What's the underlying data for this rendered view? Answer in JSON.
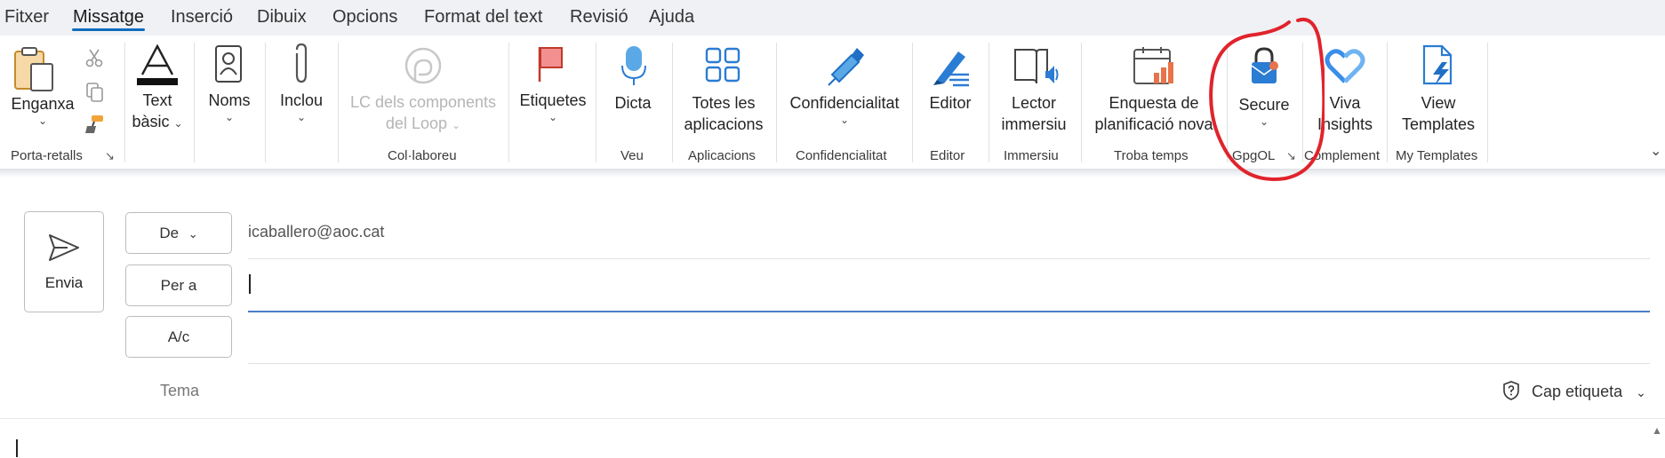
{
  "menu": {
    "items": [
      "Fitxer",
      "Missatge",
      "Inserció",
      "Dibuix",
      "Opcions",
      "Format del text",
      "Revisió",
      "Ajuda"
    ],
    "active": "Missatge"
  },
  "ribbon": {
    "clipboard": {
      "paste": "Enganxa",
      "group": "Porta-retalls"
    },
    "basic_text": {
      "line1": "Text",
      "line2": "bàsic"
    },
    "names": "Noms",
    "include": "Inclou",
    "loop": {
      "line1": "LC dels components",
      "line2": "del Loop"
    },
    "collab_group": "Col·laboreu",
    "tags": "Etiquetes",
    "dictate": "Dicta",
    "voice_group": "Veu",
    "all_apps": {
      "line1": "Totes les",
      "line2": "aplicacions"
    },
    "apps_group": "Aplicacions",
    "confidentiality": "Confidencialitat",
    "confidentiality_group": "Confidencialitat",
    "editor": "Editor",
    "editor_group": "Editor",
    "immersive": {
      "line1": "Lector",
      "line2": "immersiu"
    },
    "immersive_group": "Immersiu",
    "poll": {
      "line1": "Enquesta de",
      "line2": "planificació nova"
    },
    "time_group": "Troba temps",
    "secure": "Secure",
    "gpgol_group": "GpgOL",
    "viva": {
      "line1": "Viva",
      "line2": "Insights"
    },
    "complement_group": "Complement",
    "templates": {
      "line1": "View",
      "line2": "Templates"
    },
    "templates_group": "My Templates"
  },
  "compose": {
    "send": "Envia",
    "from_label": "De",
    "from_value": "icaballero@aoc.cat",
    "to_label": "Per a",
    "cc_label": "A/c",
    "subject_placeholder": "Tema",
    "sensitivity": "Cap etiqueta"
  },
  "colors": {
    "accent": "#0f6cbd",
    "annotation": "#e0242c"
  }
}
